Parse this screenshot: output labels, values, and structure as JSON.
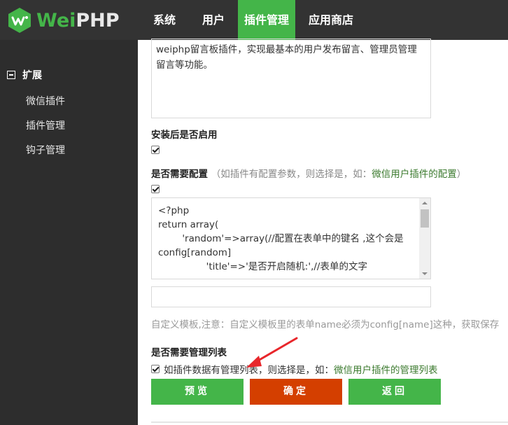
{
  "brand": {
    "wei": "Wei",
    "php": "PHP"
  },
  "nav": {
    "items": [
      "系统",
      "用户",
      "插件管理",
      "应用商店"
    ],
    "active_index": 2
  },
  "sidebar": {
    "group_label": "扩展",
    "items": [
      "微信插件",
      "插件管理",
      "钩子管理"
    ]
  },
  "form": {
    "description_text": "weiphp留言板插件，实现最基本的用户发布留言、管理员管理留言等功能。",
    "enable_after_install_label": "安装后是否启用",
    "enable_after_install_checked": true,
    "need_config_label": "是否需要配置",
    "need_config_hint_prefix": "（如插件有配置参数，则选择是，如：",
    "need_config_hint_link": "微信用户插件的配置",
    "need_config_hint_suffix": "）",
    "need_config_checked": true,
    "config_code": "<?php\nreturn array(\n        'random'=>array(//配置在表单中的键名 ,这个会是\nconfig[random]\n                'title'=>'是否开启随机:',//表单的文字",
    "template_value": "",
    "template_note": "自定义模板,注意：自定义模板里的表单name必须为config[name]这种，获取保存",
    "need_list_label": "是否需要管理列表",
    "need_list_checked": true,
    "need_list_hint_prefix": "如插件数据有管理列表，则选择是，如：",
    "need_list_hint_link": "微信用户插件的管理列表"
  },
  "buttons": {
    "preview": "预览",
    "confirm": "确定",
    "back": "返回"
  },
  "colors": {
    "brand_green": "#44b549",
    "header_bg": "#333333",
    "sidebar_bg": "#2d2d2d",
    "confirm_red": "#d43f00",
    "arrow_red": "#e8262b"
  }
}
